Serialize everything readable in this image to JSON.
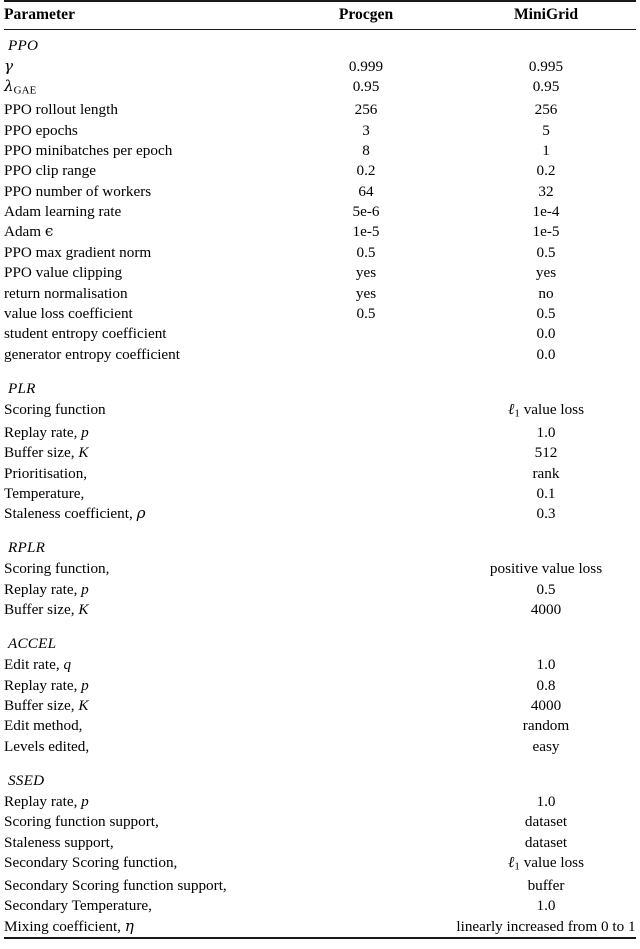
{
  "table": {
    "columns": {
      "parameter_header": "Parameter",
      "procgen_header": "Procgen",
      "minigrid_header": "MiniGrid"
    },
    "sections": [
      {
        "label": "PPO",
        "rows": [
          {
            "parameter": "γ",
            "param_kind": "greek",
            "procgen": "0.999",
            "minigrid": "0.995"
          },
          {
            "parameter": "λ",
            "param_kind": "greek-sub",
            "param_sub": "GAE",
            "procgen": "0.95",
            "minigrid": "0.95"
          },
          {
            "parameter": "PPO rollout length",
            "param_kind": "text",
            "procgen": "256",
            "minigrid": "256"
          },
          {
            "parameter": "PPO epochs",
            "param_kind": "text",
            "procgen": "3",
            "minigrid": "5"
          },
          {
            "parameter": "PPO minibatches per epoch",
            "param_kind": "text",
            "procgen": "8",
            "minigrid": "1"
          },
          {
            "parameter": "PPO clip range",
            "param_kind": "text",
            "procgen": "0.2",
            "minigrid": "0.2"
          },
          {
            "parameter": "PPO number of workers",
            "param_kind": "text",
            "procgen": "64",
            "minigrid": "32"
          },
          {
            "parameter": "Adam learning rate",
            "param_kind": "text",
            "procgen": "5e-6",
            "minigrid": "1e-4"
          },
          {
            "parameter": "Adam ",
            "param_kind": "text-greek",
            "param_greek": "ϵ",
            "procgen": "1e-5",
            "minigrid": "1e-5"
          },
          {
            "parameter": "PPO max gradient norm",
            "param_kind": "text",
            "procgen": "0.5",
            "minigrid": "0.5"
          },
          {
            "parameter": "PPO value clipping",
            "param_kind": "text",
            "procgen": "yes",
            "minigrid": "yes"
          },
          {
            "parameter": "return normalisation",
            "param_kind": "text",
            "procgen": "yes",
            "minigrid": "no"
          },
          {
            "parameter": "value loss coefficient",
            "param_kind": "text",
            "procgen": "0.5",
            "minigrid": "0.5"
          },
          {
            "parameter": "student entropy coefficient",
            "param_kind": "text",
            "procgen": "",
            "minigrid": "0.0"
          },
          {
            "parameter": "generator entropy coefficient",
            "param_kind": "text",
            "procgen": "",
            "minigrid": "0.0"
          }
        ]
      },
      {
        "label": "PLR",
        "rows": [
          {
            "parameter": "Scoring function",
            "param_kind": "text",
            "span_value": "ℓ₁ value loss",
            "value_kind": "ell1-value-loss"
          },
          {
            "parameter": "Replay rate, ",
            "param_kind": "text-italic",
            "param_italic": "p",
            "span_value": "1.0",
            "value_kind": "text"
          },
          {
            "parameter": "Buffer size, ",
            "param_kind": "text-italic",
            "param_italic": "K",
            "span_value": "512",
            "value_kind": "text"
          },
          {
            "parameter": "Prioritisation,",
            "param_kind": "text",
            "span_value": "rank",
            "value_kind": "text"
          },
          {
            "parameter": "Temperature,",
            "param_kind": "text",
            "span_value": "0.1",
            "value_kind": "text"
          },
          {
            "parameter": "Staleness coefficient, ",
            "param_kind": "text-greek-it",
            "param_greek": "ρ",
            "span_value": "0.3",
            "value_kind": "text"
          }
        ]
      },
      {
        "label": "RPLR",
        "rows": [
          {
            "parameter": "Scoring function,",
            "param_kind": "text",
            "span_value": "positive value loss",
            "value_kind": "text"
          },
          {
            "parameter": "Replay rate, ",
            "param_kind": "text-italic",
            "param_italic": "p",
            "span_value": "0.5",
            "value_kind": "text"
          },
          {
            "parameter": "Buffer size, ",
            "param_kind": "text-italic",
            "param_italic": "K",
            "span_value": "4000",
            "value_kind": "text"
          }
        ]
      },
      {
        "label": "ACCEL",
        "rows": [
          {
            "parameter": "Edit rate, ",
            "param_kind": "text-italic",
            "param_italic": "q",
            "span_value": "1.0",
            "value_kind": "text"
          },
          {
            "parameter": "Replay rate, ",
            "param_kind": "text-italic",
            "param_italic": "p",
            "span_value": "0.8",
            "value_kind": "text"
          },
          {
            "parameter": "Buffer size, ",
            "param_kind": "text-italic",
            "param_italic": "K",
            "span_value": "4000",
            "value_kind": "text"
          },
          {
            "parameter": "Edit method,",
            "param_kind": "text",
            "span_value": "random",
            "value_kind": "text"
          },
          {
            "parameter": "Levels edited,",
            "param_kind": "text",
            "span_value": "easy",
            "value_kind": "text"
          }
        ]
      },
      {
        "label": "SSED",
        "rows": [
          {
            "parameter": "Replay rate, ",
            "param_kind": "text-italic",
            "param_italic": "p",
            "span_value": "1.0",
            "value_kind": "text"
          },
          {
            "parameter": "Scoring function support,",
            "param_kind": "text",
            "span_value": "dataset",
            "value_kind": "text"
          },
          {
            "parameter": "Staleness support,",
            "param_kind": "text",
            "span_value": "dataset",
            "value_kind": "text"
          },
          {
            "parameter": "Secondary Scoring function,",
            "param_kind": "text",
            "span_value": "ℓ₁ value loss",
            "value_kind": "ell1-value-loss"
          },
          {
            "parameter": "Secondary Scoring function support,",
            "param_kind": "text",
            "span_value": "buffer",
            "value_kind": "text"
          },
          {
            "parameter": "Secondary Temperature,",
            "param_kind": "text",
            "span_value": "1.0",
            "value_kind": "text"
          },
          {
            "parameter": "Mixing coefficient, ",
            "param_kind": "text-greek-it",
            "param_greek": "η",
            "span_value": "linearly increased from 0 to 1",
            "value_kind": "text"
          }
        ]
      }
    ]
  }
}
